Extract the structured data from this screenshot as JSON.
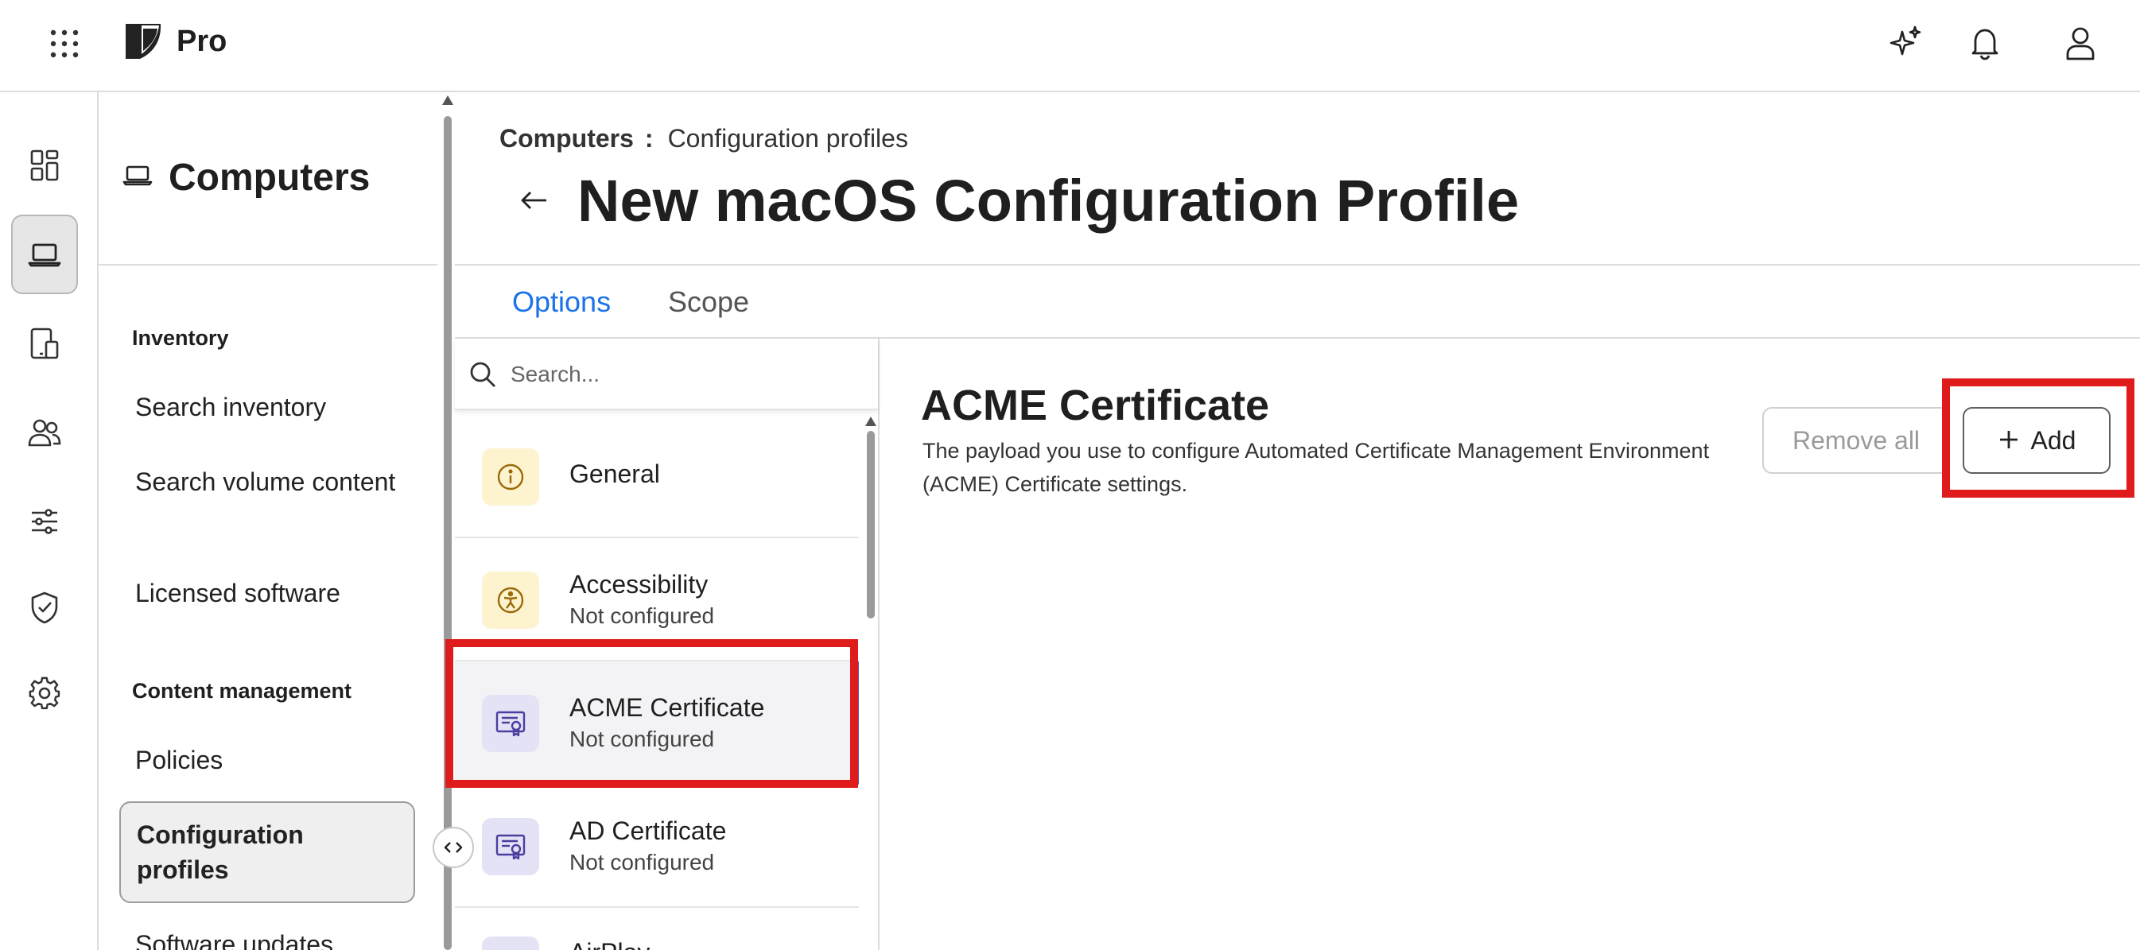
{
  "app": {
    "brand": "Pro",
    "accent_color": "#1a73e8",
    "highlight_color": "#e01b1b"
  },
  "topbar": {
    "icons": [
      "apps-grid-icon",
      "logo",
      "ai-sparkle-icon",
      "notification-bell-icon",
      "user-profile-icon"
    ]
  },
  "rail": {
    "items": [
      {
        "icon": "dashboard-icon"
      },
      {
        "icon": "laptop-icon",
        "active": true
      },
      {
        "icon": "devices-icon"
      },
      {
        "icon": "users-icon"
      },
      {
        "icon": "sliders-icon"
      },
      {
        "icon": "shield-check-icon"
      },
      {
        "icon": "settings-gear-icon"
      }
    ]
  },
  "nav": {
    "title": "Computers",
    "sections": [
      {
        "label": "Inventory",
        "links": [
          "Search inventory",
          "Search volume content",
          "Licensed software"
        ]
      },
      {
        "label": "Content management",
        "links": [
          "Policies",
          "Configuration profiles",
          "Software updates"
        ]
      }
    ],
    "active_link": "Configuration profiles"
  },
  "breadcrumb": {
    "parent": "Computers",
    "separator": ":",
    "current": "Configuration profiles"
  },
  "page": {
    "title": "New macOS Configuration Profile"
  },
  "tabs": [
    {
      "label": "Options",
      "active": true
    },
    {
      "label": "Scope",
      "active": false
    }
  ],
  "search": {
    "placeholder": "Search...",
    "value": ""
  },
  "payloads": [
    {
      "name": "General",
      "status": "",
      "icon": "info-circle-icon",
      "tone": "yellow"
    },
    {
      "name": "Accessibility",
      "status": "Not configured",
      "icon": "accessibility-icon",
      "tone": "yellow"
    },
    {
      "name": "ACME Certificate",
      "status": "Not configured",
      "icon": "certificate-icon",
      "tone": "purple",
      "selected": true
    },
    {
      "name": "AD Certificate",
      "status": "Not configured",
      "icon": "certificate-icon",
      "tone": "purple"
    },
    {
      "name": "AirPlay",
      "status": "",
      "icon": "airplay-icon",
      "tone": "purple"
    }
  ],
  "detail": {
    "title": "ACME Certificate",
    "description": "The payload you use to configure Automated Certificate Management Environment (ACME) Certificate settings.",
    "remove_all_label": "Remove all",
    "add_label": "Add"
  }
}
